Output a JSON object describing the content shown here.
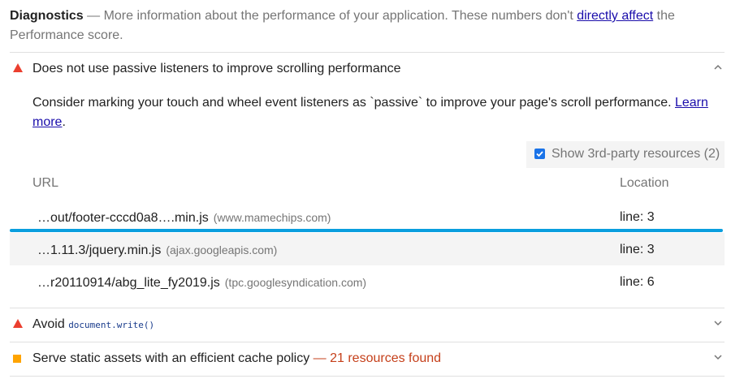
{
  "diagnostics": {
    "title": "Diagnostics",
    "text_before": " — More information about the performance of your application. These numbers don't ",
    "link": "directly affect",
    "text_after": " the Performance score."
  },
  "audits": [
    {
      "label": "Does not use passive listeners to improve scrolling performance",
      "icon": "warning-triangle-icon",
      "expanded": true
    },
    {
      "label_prefix": "Avoid ",
      "code": "document.write()",
      "icon": "warning-triangle-icon",
      "expanded": false
    },
    {
      "label": "Serve static assets with an efficient cache policy",
      "found": " — 21 resources found",
      "icon": "average-square-icon",
      "expanded": false
    }
  ],
  "passive": {
    "description": "Consider marking your touch and wheel event listeners as `passive` to improve your page's scroll performance. ",
    "learn_more": "Learn more",
    "period": ".",
    "third_party_label": "Show 3rd-party resources (2)",
    "third_party_checked": true,
    "columns": {
      "url": "URL",
      "location": "Location"
    },
    "rows": [
      {
        "url": "…out/footer-cccd0a8….min.js",
        "host": "(www.mamechips.com)",
        "location": "line: 3"
      },
      {
        "url": "…1.11.3/jquery.min.js",
        "host": "(ajax.googleapis.com)",
        "location": "line: 3"
      },
      {
        "url": "…r20110914/abg_lite_fy2019.js",
        "host": "(tpc.googlesyndication.com)",
        "location": "line: 6"
      }
    ]
  },
  "colors": {
    "fail": "#eb3f2f",
    "average": "#ffa400",
    "link": "#1a0dab",
    "highlight": "#0a9ede"
  }
}
